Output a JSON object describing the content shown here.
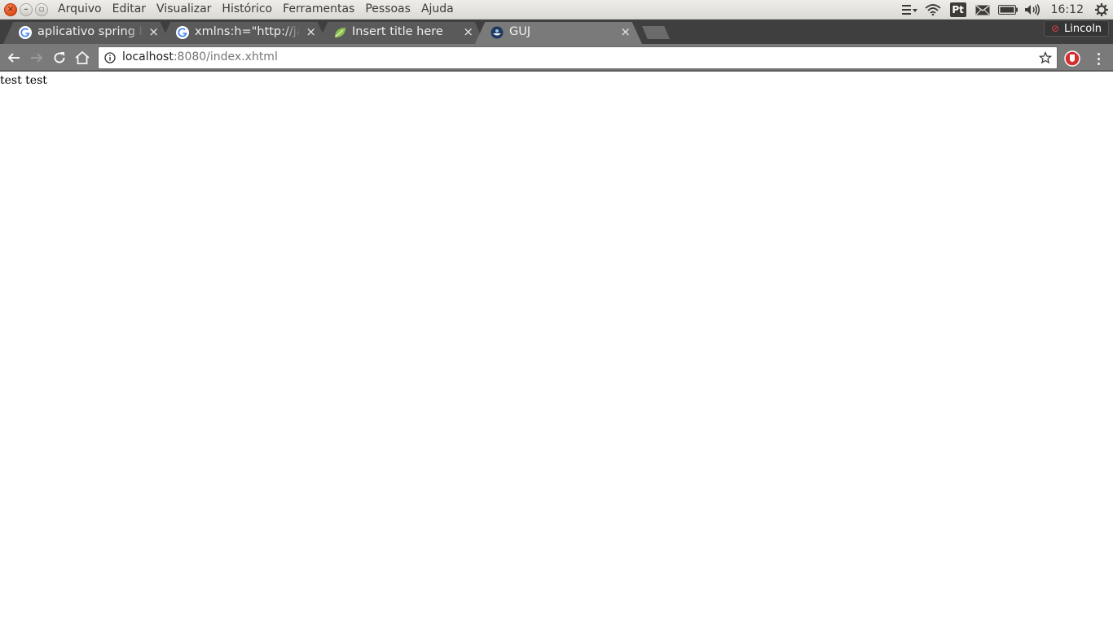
{
  "system_bar": {
    "app_menu": [
      "Arquivo",
      "Editar",
      "Visualizar",
      "Histórico",
      "Ferramentas",
      "Pessoas",
      "Ajuda"
    ],
    "keyboard_layout": "Pt",
    "clock": "16:12",
    "indicator_icons": [
      "menu-list-icon",
      "wifi-icon",
      "keyboard-icon",
      "mail-icon",
      "battery-icon",
      "volume-icon",
      "power-gear-icon"
    ]
  },
  "tabs": [
    {
      "title": "aplicativo spring boot",
      "icon": "google-icon",
      "close": "×"
    },
    {
      "title": "xmlns:h=\"http://java",
      "icon": "google-icon",
      "close": "×"
    },
    {
      "title": "Insert title here",
      "icon": "spring-leaf-icon",
      "close": "×"
    },
    {
      "title": "GUJ",
      "icon": "guj-icon",
      "close": "×",
      "active": true
    }
  ],
  "profile": {
    "name": "Lincoln",
    "icon": "profile-icon"
  },
  "address_bar": {
    "host": "localhost",
    "rest": ":8080/index.xhtml"
  },
  "page": {
    "text": "test test"
  },
  "colors": {
    "close_button": "#dd4814",
    "tab_strip": "#3f3f3f",
    "toolbar": "#7a7a7a",
    "extension_red": "#d32f2f"
  }
}
